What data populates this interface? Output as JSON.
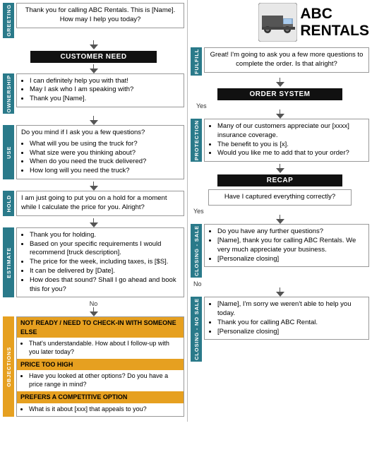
{
  "logo": {
    "company": "ABC RENTALS",
    "line1": "ABC",
    "line2": "RENTALS"
  },
  "sections": {
    "greeting": {
      "label": "GREETING",
      "color": "#2a7a8a",
      "text": "Thank you for calling ABC Rentals. This is [Name]. How may I help you today?"
    },
    "customer_need": {
      "label": "CUSTOMER NEED"
    },
    "ownership": {
      "label": "OWNERSHIP",
      "color": "#2a7a8a",
      "items": [
        "I can definitely help you with that!",
        "May I ask who I am speaking with?",
        "Thank you [Name]."
      ]
    },
    "use": {
      "label": "USE",
      "color": "#2a7a8a",
      "text": "Do you mind if I ask you a few questions?",
      "items": [
        "What will you be using the truck for?",
        "What size were you thinking about?",
        "When do you need the truck delivered?",
        "How long will you need the truck?"
      ]
    },
    "hold": {
      "label": "HOLD",
      "color": "#2a7a8a",
      "text": "I am just going to put you on a hold for a moment while I calculate the price for you.  Alright?"
    },
    "estimate": {
      "label": "ESTIMATE",
      "color": "#2a7a8a",
      "items": [
        "Thank you for holding.",
        "Based on your specific requirements I would recommend [truck description].",
        "The price for the week, including taxes, is [$S].",
        "It can be delivered by [Date].",
        "How does that sound? Shall I go ahead and book this for you?"
      ]
    },
    "objections": {
      "label": "OBJECTIONS",
      "color": "#e6a020",
      "not_ready": {
        "header": "NOT READY / NEED TO CHECK-IN WITH SOMEONE ELSE",
        "text": "That's understandable.  How about I follow-up with you later today?"
      },
      "price_too_high": {
        "header": "PRICE TOO HIGH",
        "items": [
          "Have you looked at other options?  Do you have a price range in mind?"
        ]
      },
      "competitive": {
        "header": "PREFERS A COMPETITIVE OPTION",
        "items": [
          "What is it about [xxx] that appeals to you?"
        ]
      }
    },
    "fulfill": {
      "label": "FULFILL",
      "color": "#2a7a8a",
      "text": "Great!  I'm going to ask you a few more questions to complete the order.  Is that alright?"
    },
    "order_system": {
      "label": "ORDER SYSTEM"
    },
    "protection": {
      "label": "PROTECTION",
      "color": "#2a7a8a",
      "items": [
        "Many of our customers appreciate our [xxxx] insurance coverage.",
        "The benefit to you is [x].",
        "Would you like me to add that to your order?"
      ]
    },
    "recap": {
      "label": "RECAP"
    },
    "recap_text": "Have I captured everything correctly?",
    "closing_sale": {
      "label": "CLOSING - SALE",
      "color": "#2a7a8a",
      "items": [
        "Do you have any further questions?",
        "[Name], thank you for calling ABC Rentals.  We very much appreciate your business.",
        "[Personalize closing]"
      ]
    },
    "closing_no_sale": {
      "label": "CLOSING - NO SALE",
      "color": "#2a7a8a",
      "items": [
        "[Name], I'm sorry we weren't able to help you today.",
        "Thank you for calling ABC Rental.",
        "[Personalize closing]"
      ]
    }
  },
  "flow_labels": {
    "yes": "Yes",
    "no": "No"
  }
}
